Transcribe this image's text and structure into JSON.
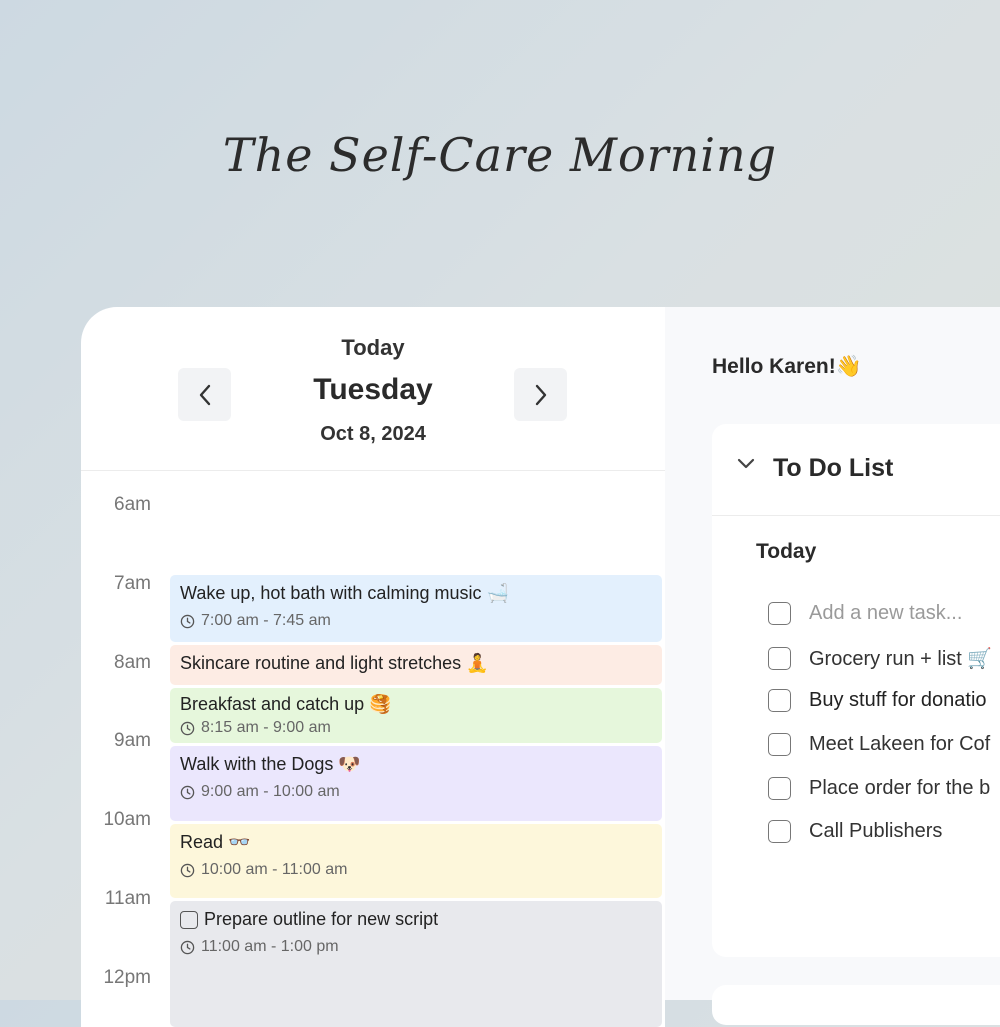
{
  "headline": "The Self-Care Morning",
  "calendar": {
    "today_label": "Today",
    "day": "Tuesday",
    "date": "Oct 8, 2024",
    "hours": [
      "6am",
      "7am",
      "8am",
      "9am",
      "10am",
      "11am",
      "12pm"
    ],
    "events": [
      {
        "title": "Wake up, hot bath with calming music 🛁",
        "time": "7:00 am - 7:45 am",
        "color": "#e3f0fd"
      },
      {
        "title": "Skincare routine and light stretches 🧘",
        "time": "",
        "color": "#fdece4"
      },
      {
        "title": "Breakfast and catch up 🥞",
        "time": "8:15 am - 9:00 am",
        "color": "#e6f7dc"
      },
      {
        "title": "Walk with the Dogs 🐶",
        "time": "9:00 am - 10:00 am",
        "color": "#ebe7fd"
      },
      {
        "title": "Read 👓",
        "time": "10:00 am - 11:00 am",
        "color": "#fdf7db"
      },
      {
        "title": "Prepare outline for new script",
        "time": "11:00 am - 1:00 pm",
        "color": "#e8e9ed"
      }
    ]
  },
  "greeting": "Hello Karen!👋",
  "todo": {
    "title": "To Do List",
    "section": "Today",
    "tasks": [
      "Add a new task...",
      "Grocery run + list 🛒",
      "Buy stuff for donatio",
      "Meet Lakeen for Cof",
      "Place order for the b",
      "Call Publishers"
    ]
  }
}
